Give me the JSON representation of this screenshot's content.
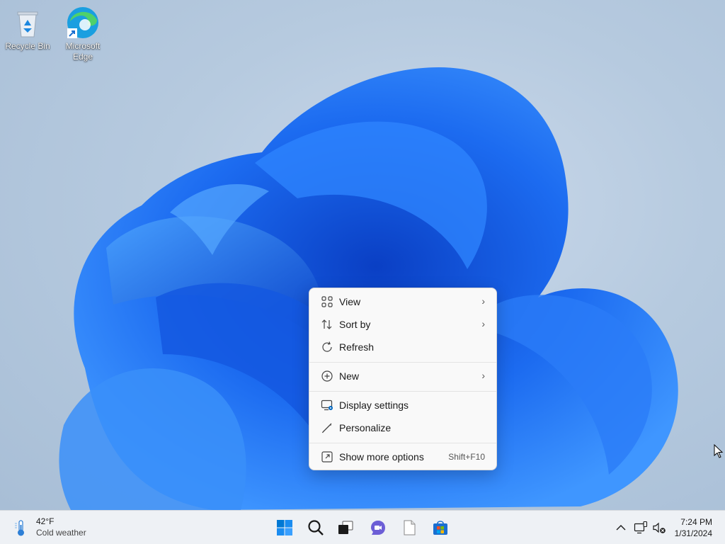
{
  "desktop": {
    "icons": [
      {
        "label": "Recycle Bin",
        "icon": "recycle-bin-icon"
      },
      {
        "label": "Microsoft Edge",
        "icon": "edge-icon"
      }
    ]
  },
  "context_menu": {
    "items": [
      {
        "label": "View",
        "icon": "view-grid-icon",
        "submenu": true
      },
      {
        "label": "Sort by",
        "icon": "sort-icon",
        "submenu": true
      },
      {
        "label": "Refresh",
        "icon": "refresh-icon"
      },
      {
        "label": "New",
        "icon": "new-plus-icon",
        "submenu": true
      },
      {
        "label": "Display settings",
        "icon": "display-settings-icon"
      },
      {
        "label": "Personalize",
        "icon": "pen-icon"
      },
      {
        "label": "Show more options",
        "icon": "show-more-icon",
        "accelerator": "Shift+F10"
      }
    ],
    "chevron": "›"
  },
  "taskbar": {
    "weather": {
      "temp": "42°F",
      "desc": "Cold weather",
      "icon": "thermometer-icon"
    },
    "apps": [
      "start-icon",
      "search-icon",
      "task-view-icon",
      "teams-chat-icon",
      "notepad-icon",
      "store-icon"
    ],
    "tray": [
      "chevron-up-icon",
      "network-icon",
      "volume-muted-icon"
    ],
    "clock": {
      "time": "7:24 PM",
      "date": "1/31/2024"
    }
  },
  "colors": {
    "accent": "#0078d4",
    "bloom": "#1a5fe0"
  }
}
